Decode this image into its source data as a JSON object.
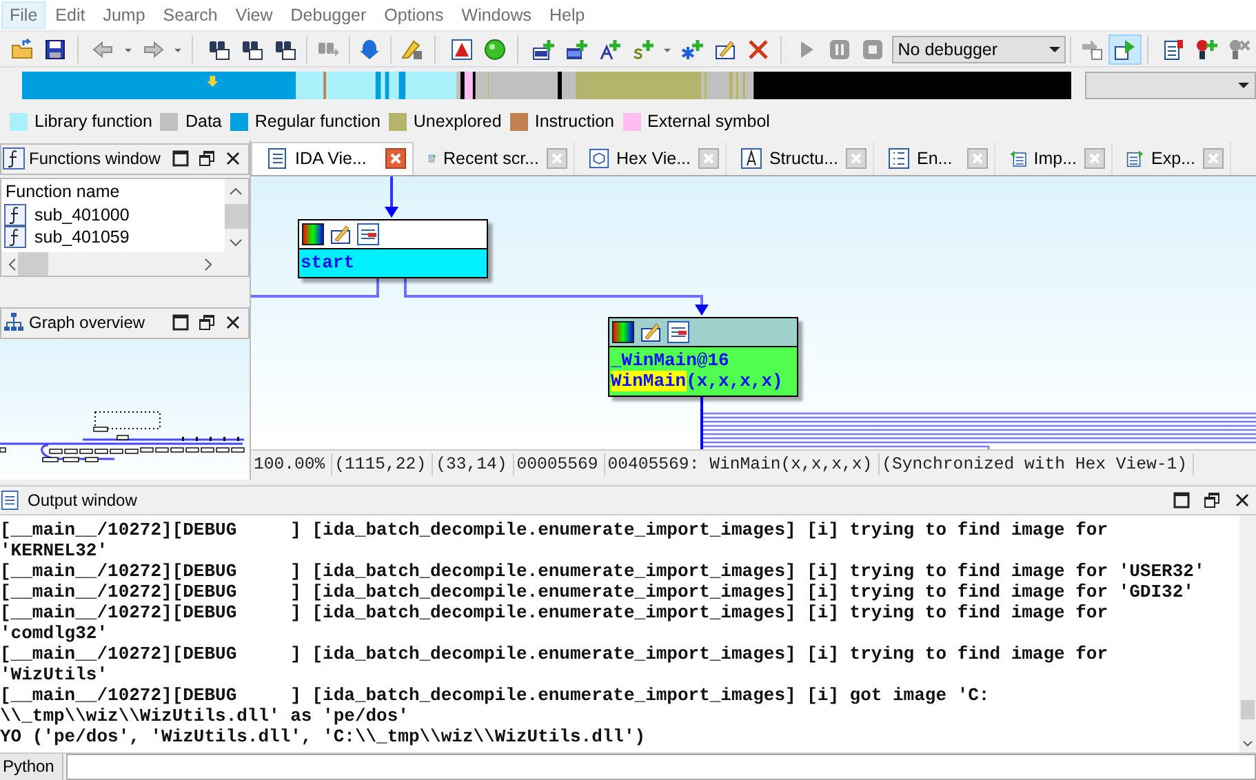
{
  "menu": [
    {
      "label": "File",
      "selected": true
    },
    {
      "label": "Edit",
      "selected": false
    },
    {
      "label": "Jump",
      "selected": false
    },
    {
      "label": "Search",
      "selected": false
    },
    {
      "label": "View",
      "selected": false
    },
    {
      "label": "Debugger",
      "selected": false
    },
    {
      "label": "Options",
      "selected": false
    },
    {
      "label": "Windows",
      "selected": false
    },
    {
      "label": "Help",
      "selected": false
    }
  ],
  "toolbar": {
    "buttons": [
      {
        "pressed": false
      },
      {
        "pressed": false
      },
      {
        "pressed": false
      },
      {
        "pressed": false
      },
      {
        "pressed": false
      },
      {
        "pressed": false
      },
      {
        "pressed": false
      },
      {
        "pressed": false
      },
      {
        "pressed": false
      },
      {
        "pressed": false
      },
      {
        "pressed": false
      },
      {
        "pressed": false
      },
      {
        "pressed": false
      },
      {
        "pressed": false
      },
      {
        "pressed": false
      },
      {
        "pressed": false
      },
      {
        "pressed": false
      },
      {
        "pressed": false
      },
      {
        "pressed": false
      },
      {
        "pressed": false
      },
      {
        "pressed": false
      },
      {
        "pressed": false
      },
      {
        "pressed": false
      },
      {
        "pressed": false
      },
      {
        "pressed": false
      },
      {
        "pressed": false
      },
      {
        "pressed": true
      },
      {
        "pressed": false
      },
      {
        "pressed": false
      },
      {
        "pressed": false
      }
    ],
    "debugger_select": {
      "value": "No debugger"
    }
  },
  "legend": [
    {
      "label": "Library function",
      "color": "#aaf0fa"
    },
    {
      "label": "Data",
      "color": "#c0c0c0"
    },
    {
      "label": "Regular function",
      "color": "#00a0e0"
    },
    {
      "label": "Unexplored",
      "color": "#b4b46c"
    },
    {
      "label": "Instruction",
      "color": "#c08050"
    },
    {
      "label": "External symbol",
      "color": "#ffbcf0"
    }
  ],
  "functions_window": {
    "title": "Functions window",
    "column": "Function name",
    "rows": [
      "sub_401000",
      "sub_401059"
    ]
  },
  "graph_overview": {
    "title": "Graph overview"
  },
  "tabs": [
    {
      "label": "IDA Vie...",
      "selected": true
    },
    {
      "label": "Recent scr...",
      "selected": false
    },
    {
      "label": "Hex Vie...",
      "selected": false
    },
    {
      "label": "Structu...",
      "selected": false
    },
    {
      "label": "En...",
      "selected": false
    },
    {
      "label": "Imp...",
      "selected": false
    },
    {
      "label": "Exp...",
      "selected": false
    }
  ],
  "graph": {
    "nodes": [
      {
        "color": "#00f0ff",
        "selected": false,
        "lines": [
          {
            "parts": [
              {
                "text": "start",
                "highlighted": false
              }
            ]
          }
        ]
      },
      {
        "color": "#50ff50",
        "selected": true,
        "lines": [
          {
            "parts": [
              {
                "text": "_WinMain@16",
                "highlighted": false
              }
            ]
          },
          {
            "parts": [
              {
                "text": "WinMain",
                "highlighted": true
              },
              {
                "text": "(x,x,x,x)",
                "highlighted": false
              }
            ]
          }
        ]
      }
    ]
  },
  "status": [
    "100.00%",
    "(1115,22)",
    "(33,14)",
    "00005569",
    "00405569: WinMain(x,x,x,x)",
    "(Synchronized with Hex View-1)"
  ],
  "output": {
    "title": "Output window",
    "lines": [
      "[__main__/10272][DEBUG     ] [ida_batch_decompile.enumerate_import_images] [i] trying to find image for",
      "'KERNEL32'",
      "[__main__/10272][DEBUG     ] [ida_batch_decompile.enumerate_import_images] [i] trying to find image for 'USER32'",
      "[__main__/10272][DEBUG     ] [ida_batch_decompile.enumerate_import_images] [i] trying to find image for 'GDI32'",
      "[__main__/10272][DEBUG     ] [ida_batch_decompile.enumerate_import_images] [i] trying to find image for",
      "'comdlg32'",
      "[__main__/10272][DEBUG     ] [ida_batch_decompile.enumerate_import_images] [i] trying to find image for",
      "'WizUtils'",
      "[__main__/10272][DEBUG     ] [ida_batch_decompile.enumerate_import_images] [i] got image 'C:",
      "\\\\_tmp\\\\wiz\\\\WizUtils.dll' as 'pe/dos'",
      "YO ('pe/dos', 'WizUtils.dll', 'C:\\\\_tmp\\\\wiz\\\\WizUtils.dll')"
    ]
  },
  "python": {
    "label": "Python"
  }
}
